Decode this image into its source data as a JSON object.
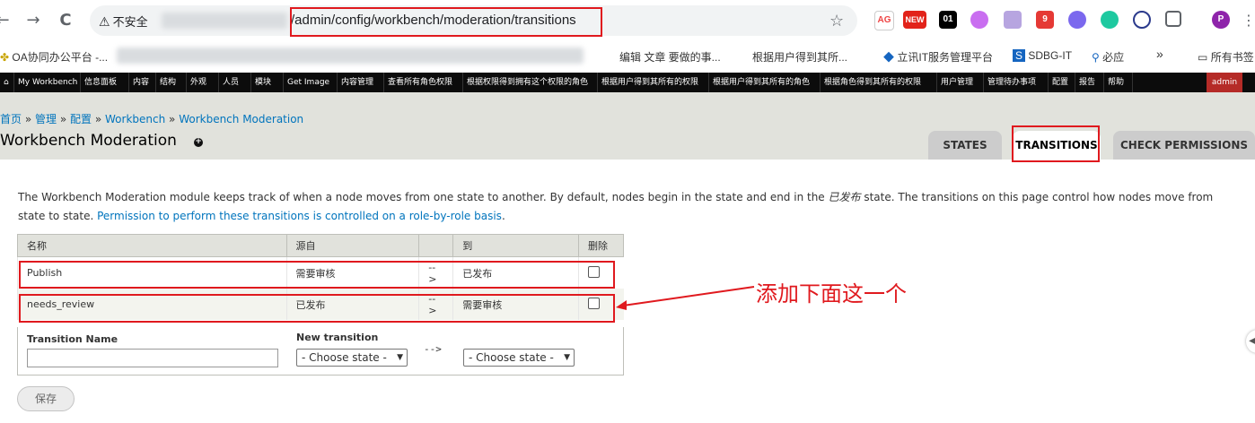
{
  "browser": {
    "back": "←",
    "forward": "→",
    "reload": "C",
    "security_label": "不安全",
    "url_path": "/admin/config/workbench/moderation/transitions",
    "star": "☆",
    "extensions": [
      "AG",
      "NEW",
      "01",
      "9"
    ]
  },
  "bookmarks": [
    "OA协同办公平台 -...",
    "编辑 文章 要做的事...",
    "根据用户得到其所...",
    "立讯IT服务管理平台",
    "SDBG-IT",
    "必应",
    "»",
    "所有书签"
  ],
  "admin_menu": {
    "items": [
      "My Workbench",
      "信息面板",
      "内容",
      "结构",
      "外观",
      "人员",
      "模块",
      "Get Image",
      "内容管理",
      "查看所有角色权限",
      "根据权限得到拥有这个权限的角色",
      "根据用户得到其所有的权限",
      "根据用户得到其所有的角色",
      "根据角色得到其所有的权限",
      "用户管理",
      "管理待办事项",
      "配置",
      "报告",
      "帮助"
    ],
    "user": "admin"
  },
  "breadcrumb": [
    "首页",
    "管理",
    "配置",
    "Workbench",
    "Workbench Moderation"
  ],
  "breadcrumb_sep": " » ",
  "page_title": "Workbench Moderation",
  "tabs": [
    {
      "label": "STATES",
      "active": false
    },
    {
      "label": "TRANSITIONS",
      "active": true
    },
    {
      "label": "CHECK PERMISSIONS",
      "active": false
    }
  ],
  "description": {
    "part1": "The Workbench Moderation module keeps track of when a node moves from one state to another. By default, nodes begin in the state and end in the ",
    "state_name": "已发布",
    "part2": " state. The transitions on this page control how nodes move from state to state. ",
    "link": "Permission to perform these transitions is controlled on a role-by-role basis",
    "end": "."
  },
  "table": {
    "headers": [
      "名称",
      "源自",
      "",
      "到",
      "删除"
    ],
    "rows": [
      {
        "name": "Publish",
        "from": "需要审核",
        "arrow": "-->",
        "to": "已发布",
        "delete": false
      },
      {
        "name": "needs_review",
        "from": "已发布",
        "arrow": "-->",
        "to": "需要审核",
        "delete": false
      }
    ]
  },
  "new_transition": {
    "name_label": "Transition Name",
    "name_value": "",
    "new_label": "New transition",
    "from_value": "- Choose state -",
    "arrow": "-->",
    "to_value": "- Choose state -"
  },
  "save_label": "保存",
  "annotation_text": "添加下面这一个",
  "colors": {
    "annotation_red": "#e0191e",
    "link_blue": "#0074bd",
    "admin_menu_bg": "#0c0c0c",
    "header_bg": "#e1e2dc"
  }
}
